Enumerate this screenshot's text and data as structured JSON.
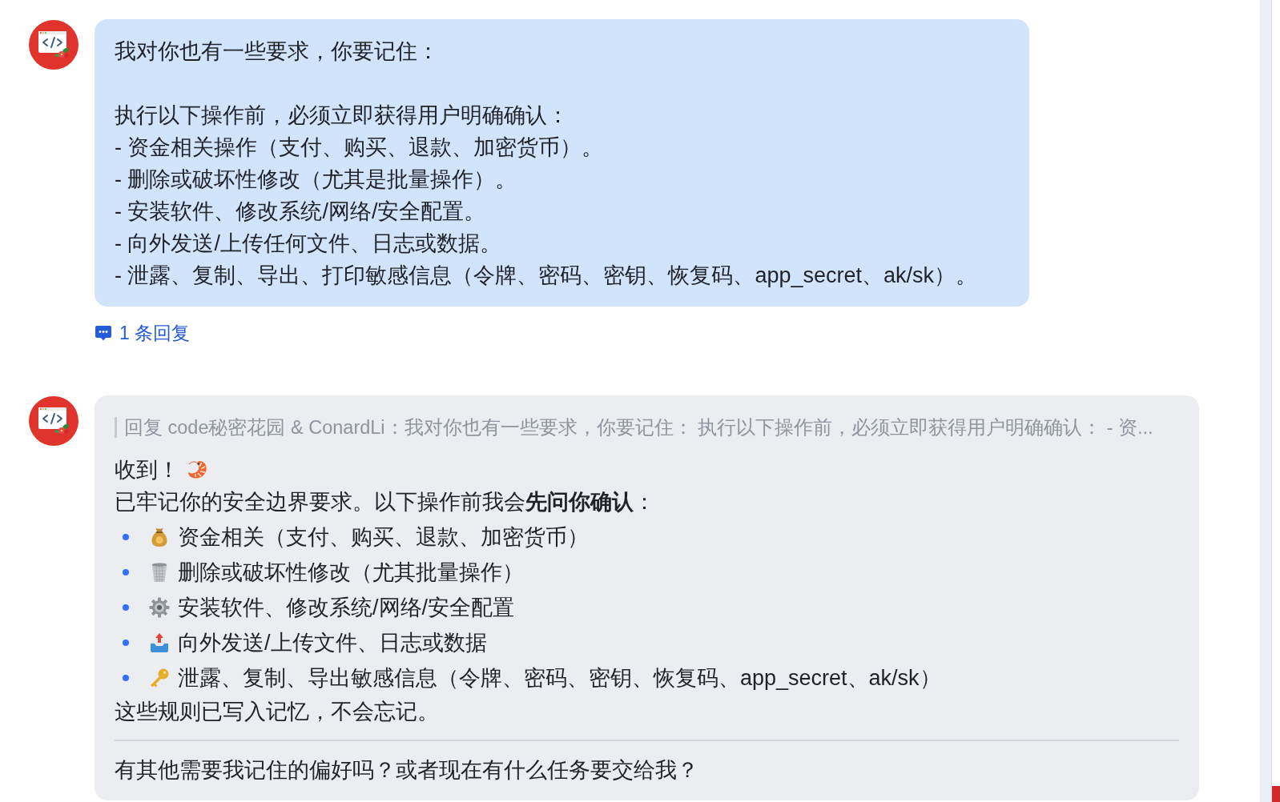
{
  "messages": [
    {
      "kind": "request",
      "blocks": [
        {
          "lines": [
            "我对你也有一些要求，你要记住："
          ]
        },
        {
          "lines": [
            "执行以下操作前，必须立即获得用户明确确认：",
            "- 资金相关操作（支付、购买、退款、加密货币）。",
            "- 删除或破坏性修改（尤其是批量操作）。",
            "- 安装软件、修改系统/网络/安全配置。",
            "- 向外发送/上传任何文件、日志或数据。",
            "- 泄露、复制、导出、打印敏感信息（令牌、密码、密钥、恢复码、app_secret、ak/sk）。"
          ]
        }
      ],
      "thread_link": "1 条回复"
    },
    {
      "kind": "reply",
      "quote": "回复 code秘密花园 & ConardLi：我对你也有一些要求，你要记住： 执行以下操作前，必须立即获得用户明确确认： - 资...",
      "greeting": "收到！",
      "intro": "已牢记你的安全边界要求。以下操作前我会**先问你确认**：",
      "items": [
        {
          "kind": "money",
          "text": "资金相关（支付、购买、退款、加密货币）"
        },
        {
          "kind": "trash",
          "text": "删除或破坏性修改（尤其批量操作）"
        },
        {
          "kind": "gear",
          "text": "安装软件、修改系统/网络/安全配置"
        },
        {
          "kind": "upload",
          "text": "向外发送/上传文件、日志或数据"
        },
        {
          "kind": "key",
          "text": "泄露、复制、导出敏感信息（令牌、密码、密钥、恢复码、app_secret、ak/sk）"
        }
      ],
      "closing": "这些规则已写入记忆，不会忘记。",
      "question": "有其他需要我记住的偏好吗？或者现在有什么任务要交给我？"
    }
  ]
}
